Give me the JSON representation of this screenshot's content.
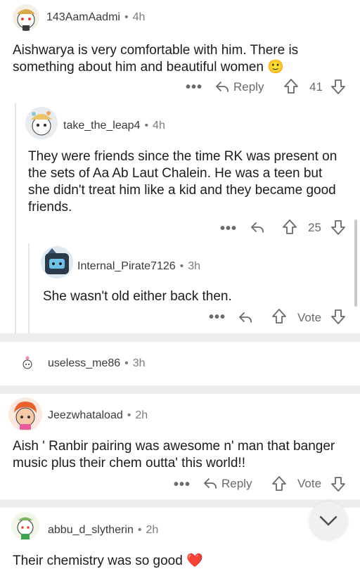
{
  "comments": [
    {
      "username": "143AamAadmi",
      "age": "4h",
      "text": "Aishwarya is very comfortable with him. There is something about him and beautiful women",
      "emoji": "🙂",
      "reply_label": "Reply",
      "votes": "41"
    },
    {
      "username": "take_the_leap4",
      "age": "4h",
      "text": "They were friends since the time RK was present on the sets of Aa Ab Laut Chalein. He was a teen but she didn't treat him like a kid and they became good friends.",
      "votes": "25"
    },
    {
      "username": "Internal_Pirate7126",
      "age": "3h",
      "text": "She wasn't old either back then.",
      "votes": "Vote"
    },
    {
      "username": "useless_me86",
      "age": "3h"
    },
    {
      "username": "Jeezwhataload",
      "age": "2h",
      "text": "Aish ' Ranbir pairing was awesome n' man that banger music plus their chem outta' this world!!",
      "reply_label": "Reply",
      "votes": "Vote"
    },
    {
      "username": "abbu_d_slytherin",
      "age": "2h",
      "text": "Their chemistry was so good",
      "emoji": "❤️"
    }
  ],
  "more_label": "•••",
  "separator_dot": "•",
  "colors": {
    "separator": "#ededed",
    "thread_line": "#e6e6e6",
    "meta": "#7c7c7c"
  },
  "icons": [
    "reply-arrow-icon",
    "upvote-icon",
    "downvote-icon",
    "more-icon",
    "chevron-down-icon",
    "avatar"
  ]
}
